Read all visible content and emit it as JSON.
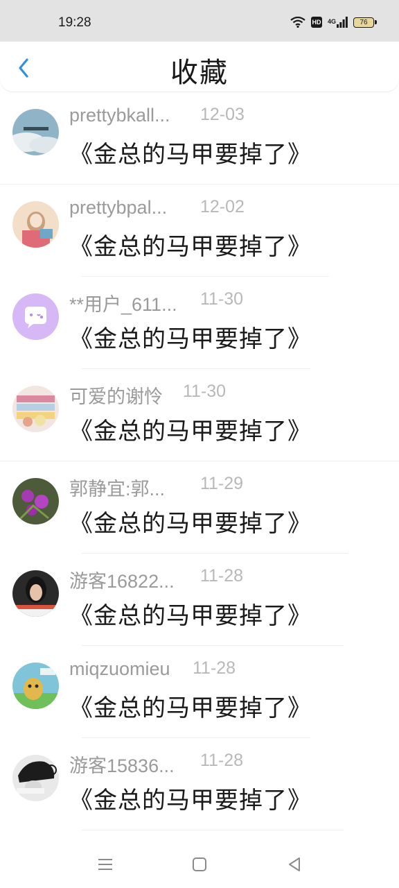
{
  "status_bar": {
    "time": "19:28",
    "icons": [
      "wifi-icon",
      "hd-icon",
      "4g-signal-icon",
      "battery-icon"
    ],
    "hd_label": "HD",
    "network_label": "4G",
    "battery_level": "76"
  },
  "header": {
    "title": "收藏",
    "back_icon": "chevron-left-icon",
    "accent_color": "#2f8fe3"
  },
  "favorites": [
    {
      "username": "prettybkall...",
      "date": "12-03",
      "title": "《金总的马甲要掉了》"
    },
    {
      "username": "prettybpal...",
      "date": "12-02",
      "title": "《金总的马甲要掉了》"
    },
    {
      "username": "**用户_611...",
      "date": "11-30",
      "title": "《金总的马甲要掉了》"
    },
    {
      "username": "可爱的谢怜",
      "date": "11-30",
      "title": "《金总的马甲要掉了》"
    },
    {
      "username": "郭静宜:郭...",
      "date": "11-29",
      "title": "《金总的马甲要掉了》"
    },
    {
      "username": "游客16822...",
      "date": "11-28",
      "title": "《金总的马甲要掉了》"
    },
    {
      "username": "miqzuomieu",
      "date": "11-28",
      "title": "《金总的马甲要掉了》"
    },
    {
      "username": "游客15836...",
      "date": "11-28",
      "title": "《金总的马甲要掉了》"
    }
  ],
  "nav_bar": {
    "icons": [
      "menu-icon",
      "home-icon",
      "back-triangle-icon"
    ]
  }
}
